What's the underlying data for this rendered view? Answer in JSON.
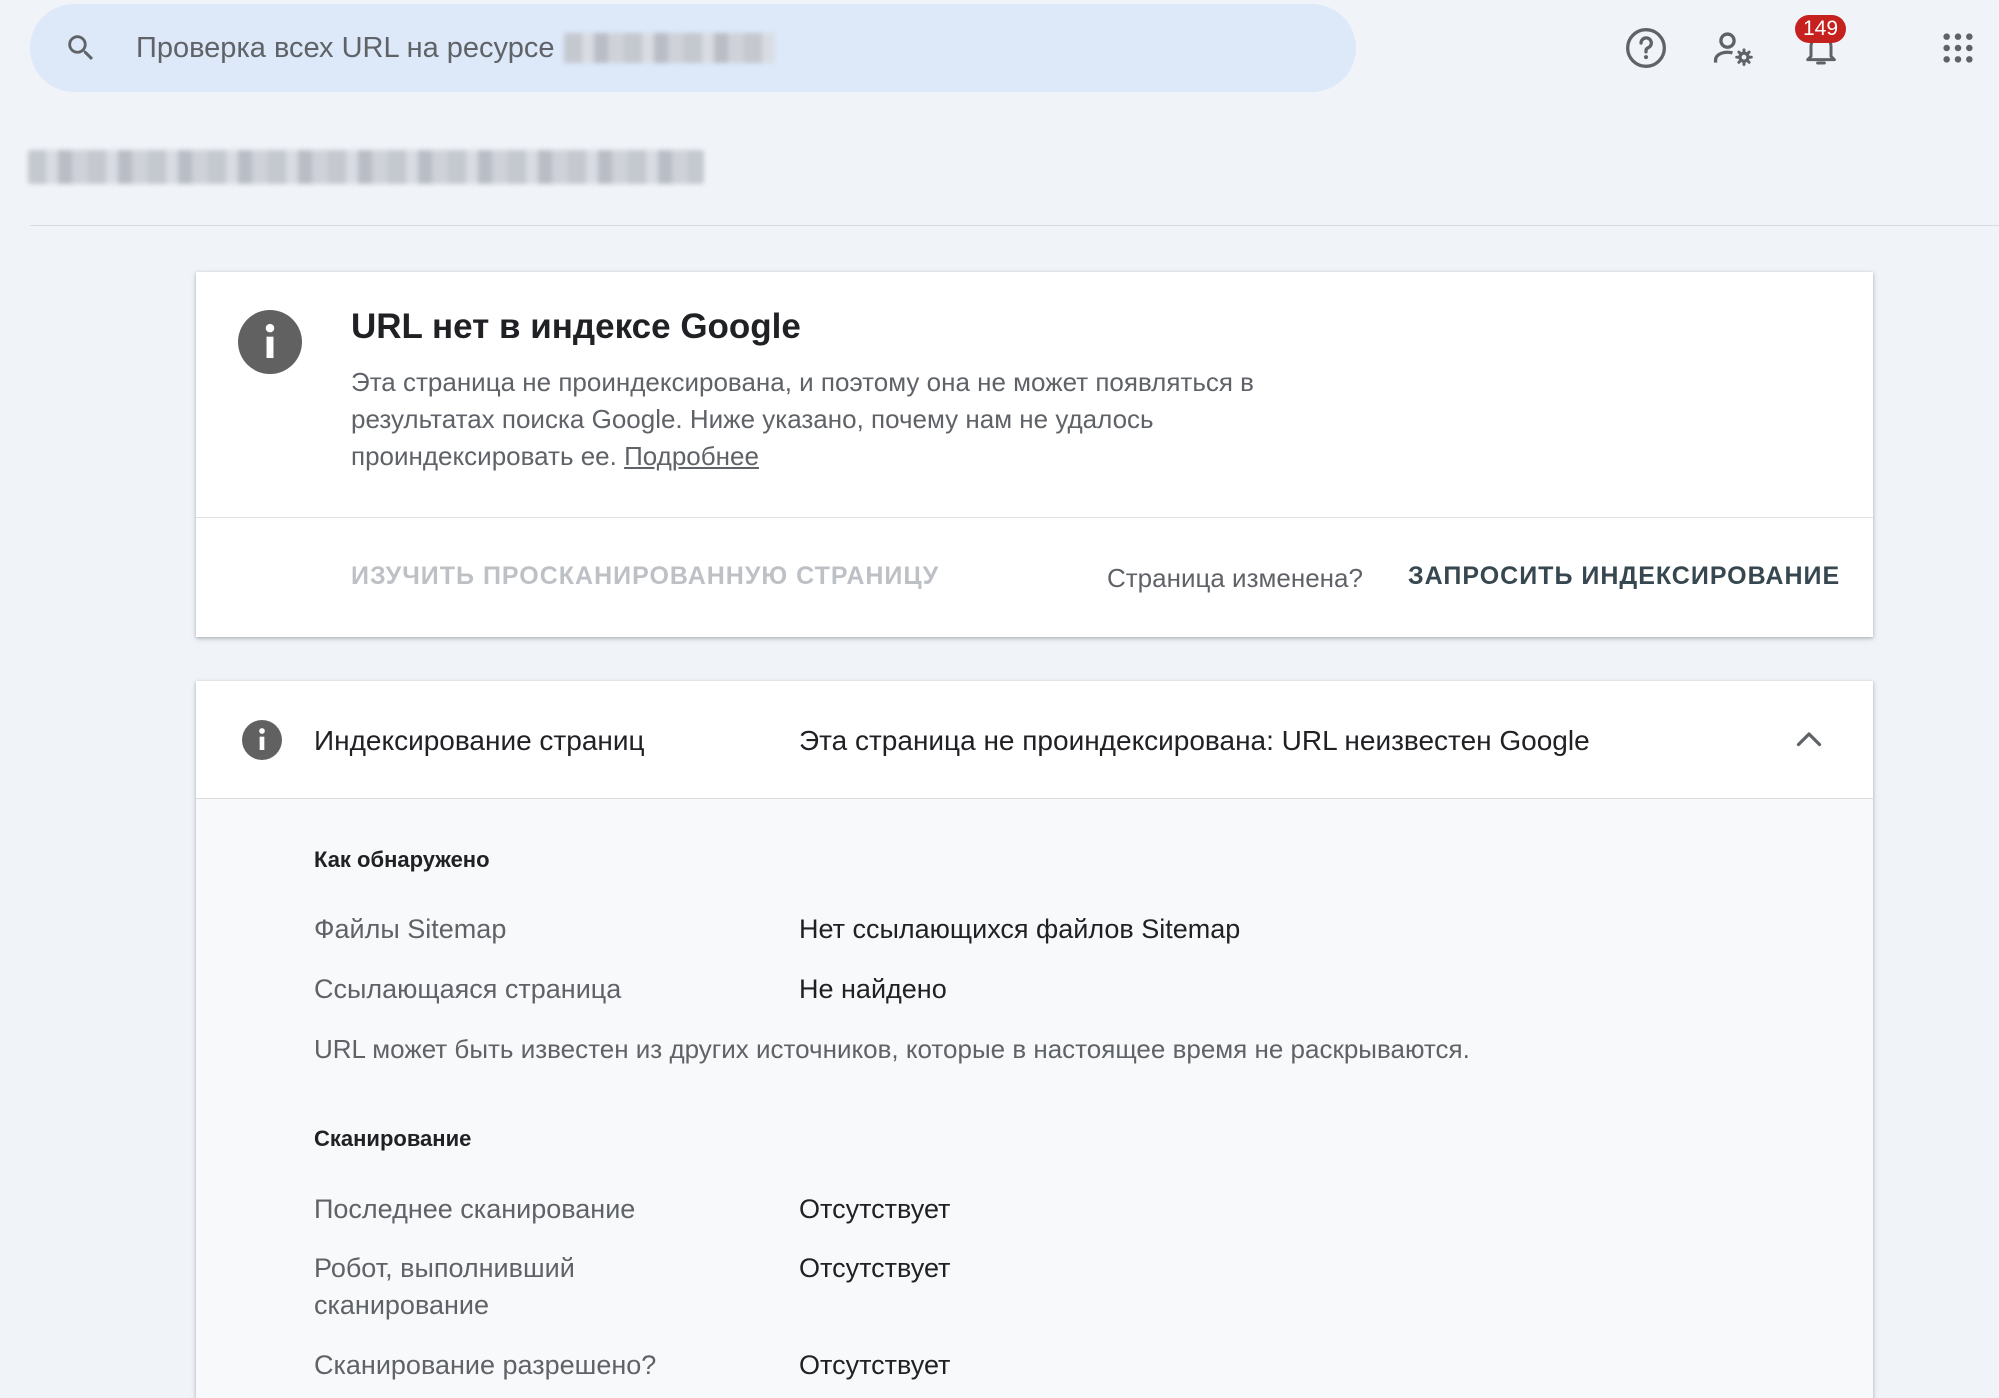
{
  "header": {
    "search_placeholder": "Проверка всех URL на ресурсе",
    "notifications_count": "149",
    "icons": [
      "search-icon",
      "help-icon",
      "admin-icon",
      "notifications-icon",
      "apps-icon"
    ]
  },
  "status_card": {
    "title": "URL нет в индексе Google",
    "description": "Эта страница не проиндексирована, и поэтому она не может появляться в результатах поиска Google. Ниже указано, почему нам не удалось проиндексировать ее.",
    "learn_more": "Подробнее",
    "inspect_button": "ИЗУЧИТЬ ПРОСКАНИРОВАННУЮ СТРАНИЦУ",
    "changed_label": "Страница изменена?",
    "request_button": "ЗАПРОСИТЬ ИНДЕКСИРОВАНИЕ"
  },
  "indexing": {
    "label": "Индексирование страниц",
    "status": "Эта страница не проиндексирована: URL неизвестен Google",
    "discovery": {
      "heading": "Как обнаружено",
      "rows": [
        {
          "label": "Файлы Sitemap",
          "value": "Нет ссылающихся файлов Sitemap"
        },
        {
          "label": "Ссылающаяся страница",
          "value": "Не найдено"
        }
      ],
      "note": "URL может быть известен из других источников, которые в настоящее время не раскрываются."
    },
    "crawl": {
      "heading": "Сканирование",
      "rows": [
        {
          "label": "Последнее сканирование",
          "value": "Отсутствует"
        },
        {
          "label": "Робот, выполнивший сканирование",
          "value": "Отсутствует"
        },
        {
          "label": "Сканирование разрешено?",
          "value": "Отсутствует"
        }
      ]
    }
  },
  "colors": {
    "background": "#f0f4f9",
    "search_bg": "#dde8f8",
    "badge": "#c5221f",
    "info_icon": "#616161",
    "request_button": "#37474f"
  }
}
